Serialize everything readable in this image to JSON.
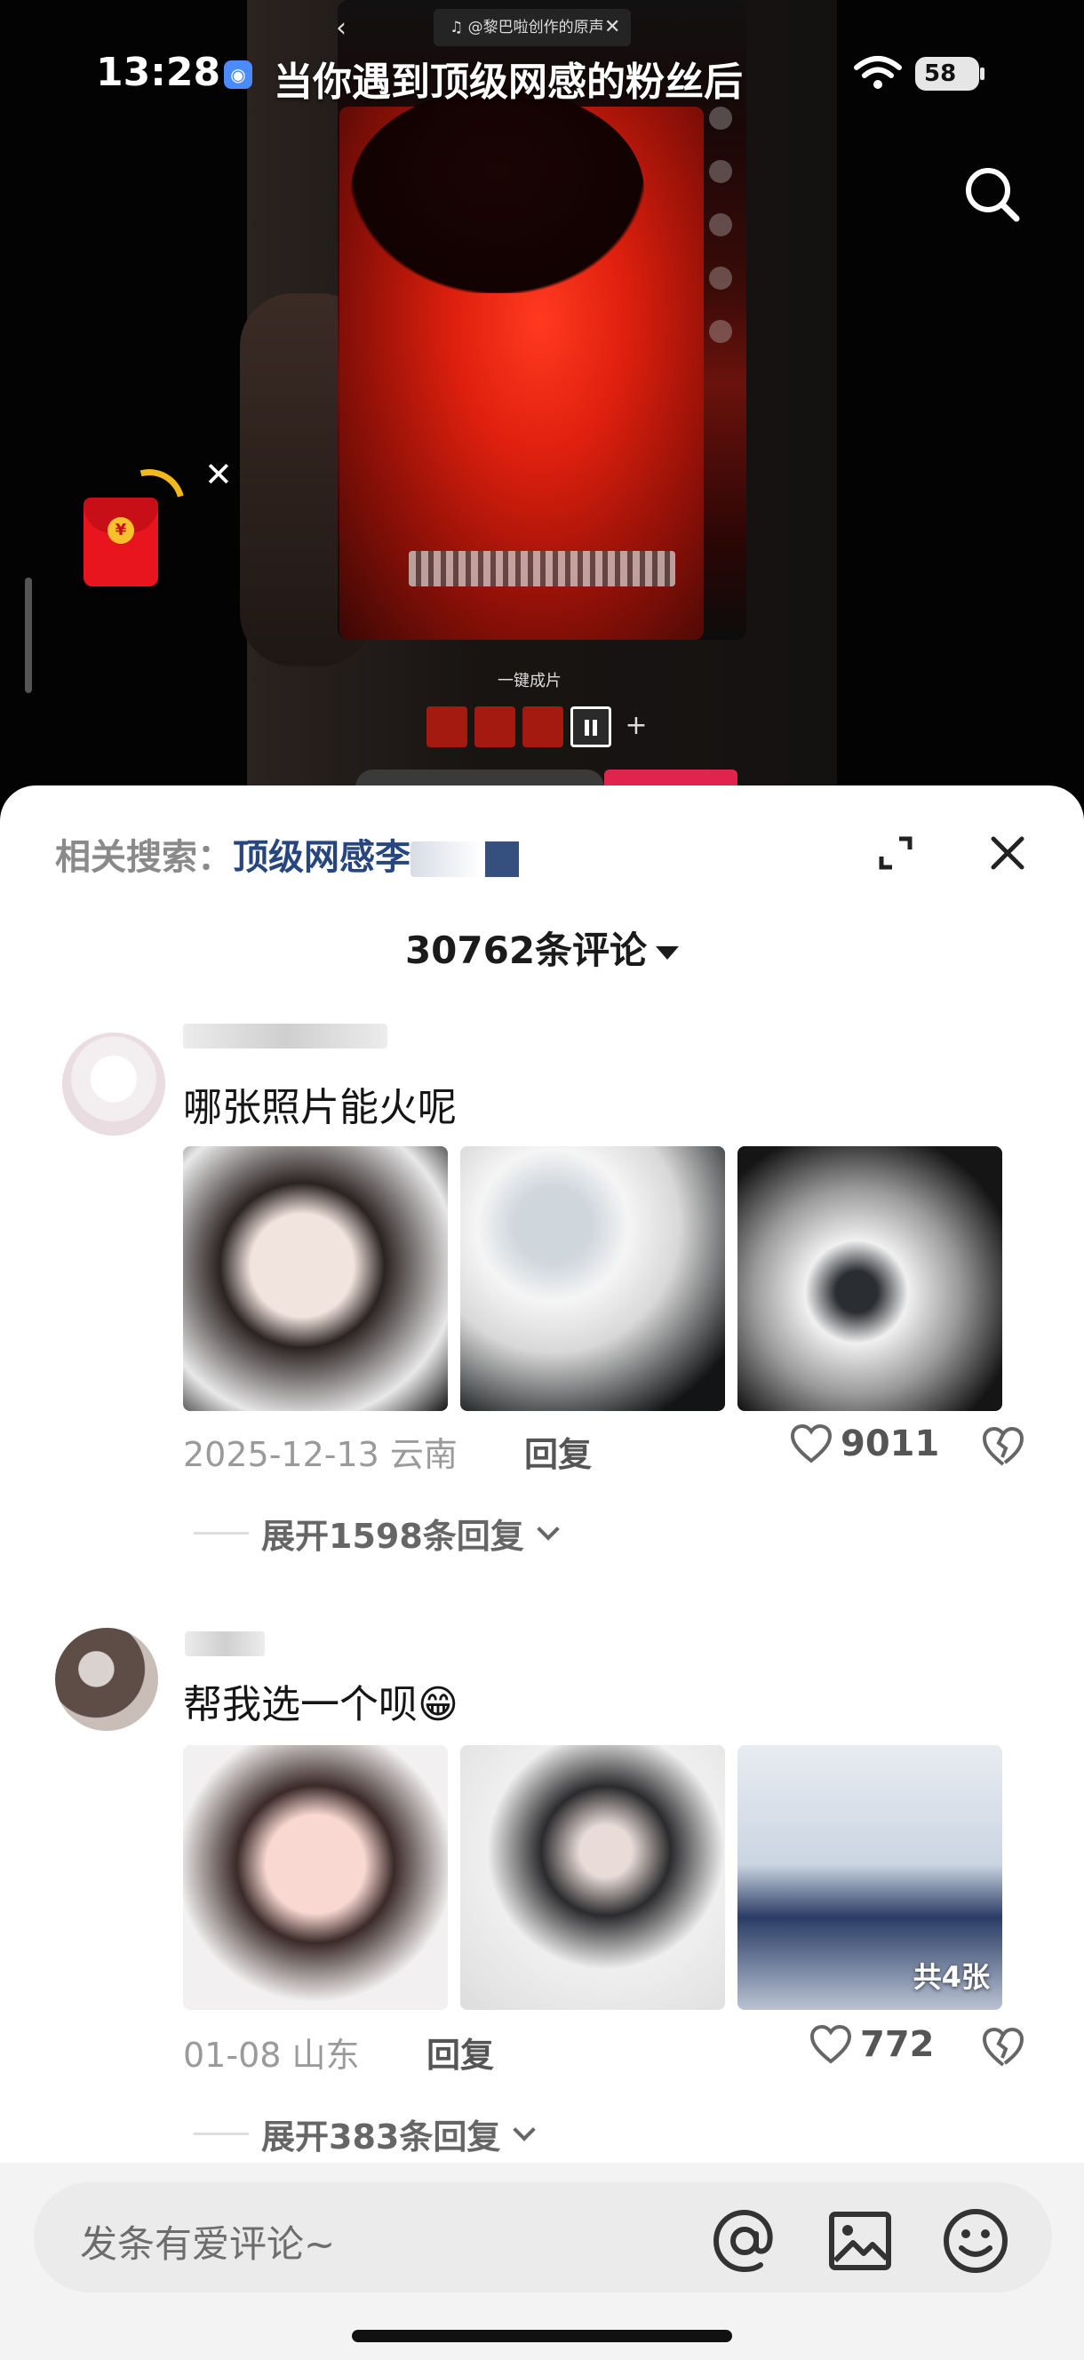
{
  "status_bar": {
    "time": "13:28",
    "battery": "58"
  },
  "video": {
    "title": "当你遇到顶级网感的粉丝后",
    "music": "♫ @黎巴啦创作的原声",
    "one_key_label": "一键成片"
  },
  "envelope": {
    "coin_symbol": "¥"
  },
  "comments_panel": {
    "related_label": "相关搜索：",
    "related_term": "顶级网感李",
    "count_label": "30762条评论",
    "comments": [
      {
        "text": "哪张照片能火呢",
        "meta": "2025-12-13 云南",
        "reply_label": "回复",
        "likes": "9011",
        "expand_label": "展开1598条回复"
      },
      {
        "text": "帮我选一个呗😁",
        "meta": "01-08 山东",
        "reply_label": "回复",
        "likes": "772",
        "expand_label": "展开383条回复",
        "photo_badge": "共4张"
      }
    ]
  },
  "input": {
    "placeholder": "发条有爱评论~"
  }
}
